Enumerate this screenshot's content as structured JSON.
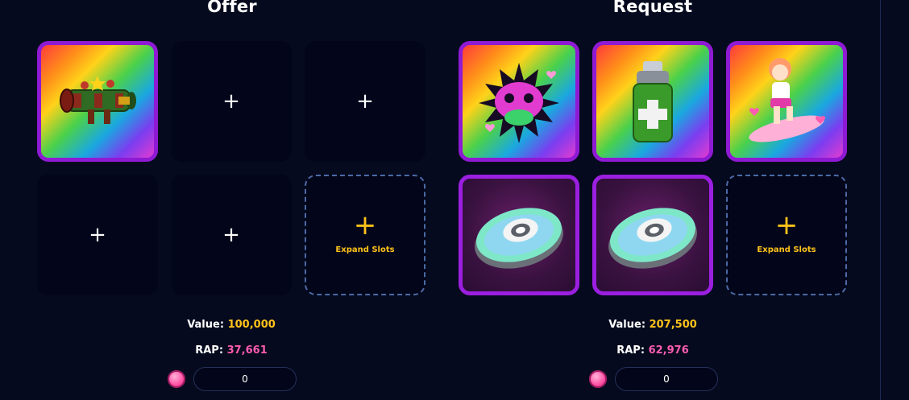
{
  "offer": {
    "title": "Offer",
    "empty_symbol": "+",
    "expand": {
      "symbol": "+",
      "label": "Expand Slots"
    },
    "value_label": "Value:",
    "value": "100,000",
    "rap_label": "RAP:",
    "rap": "37,661",
    "amount": "0",
    "items": [
      {
        "icon": "rainbow-bazooka-icon"
      }
    ]
  },
  "request": {
    "title": "Request",
    "expand": {
      "symbol": "+",
      "label": "Expand Slots"
    },
    "value_label": "Value:",
    "value": "207,500",
    "rap_label": "RAP:",
    "rap": "62,976",
    "amount": "0",
    "items": [
      {
        "icon": "rainbow-spiked-heart-icon"
      },
      {
        "icon": "rainbow-spray-can-icon"
      },
      {
        "icon": "rainbow-hoverboard-girl-icon"
      },
      {
        "icon": "holo-disc-icon"
      },
      {
        "icon": "holo-disc-icon"
      }
    ]
  },
  "colors": {
    "background": "#050a1e",
    "item_border": "#8e1ad3",
    "gold": "#ffc21a",
    "pink": "#ff5cb0",
    "dashed_border": "#4c6aa6"
  }
}
